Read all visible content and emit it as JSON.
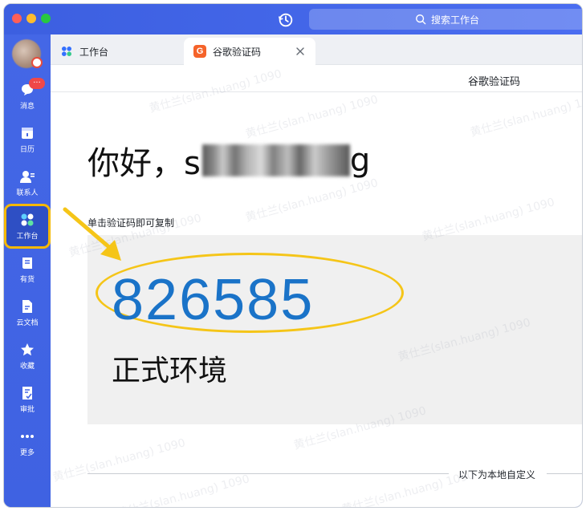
{
  "search": {
    "placeholder": "搜索工作台"
  },
  "sidebar": {
    "message_badge": "···",
    "items": [
      {
        "label": "消息",
        "icon": "chat-bubble-icon"
      },
      {
        "label": "日历",
        "icon": "calendar-icon"
      },
      {
        "label": "联系人",
        "icon": "contacts-icon"
      },
      {
        "label": "工作台",
        "icon": "workspace-grid-icon",
        "active": true
      },
      {
        "label": "有货",
        "icon": "book-icon"
      },
      {
        "label": "云文档",
        "icon": "cloud-doc-icon"
      },
      {
        "label": "收藏",
        "icon": "star-icon"
      },
      {
        "label": "审批",
        "icon": "approval-icon"
      },
      {
        "label": "更多",
        "icon": "more-dots-icon"
      }
    ]
  },
  "tabs": [
    {
      "label": "工作台",
      "icon": "workspace-grid-icon"
    },
    {
      "label": "谷歌验证码",
      "icon": "google-g-icon",
      "icon_letter": "G",
      "active": true
    }
  ],
  "page": {
    "header_title": "谷歌验证码",
    "greeting_prefix": "你好，s",
    "greeting_suffix": "g",
    "copy_hint": "单击验证码即可复制",
    "code": "826585",
    "environment": "正式环境",
    "divider_label": "以下为本地自定义"
  },
  "watermark": "黄仕兰(slan.huang) 1090",
  "colors": {
    "accent_blue": "#3f62e2",
    "code_blue": "#1a73c8",
    "annotation_yellow": "#f5c518",
    "badge_red": "#f04848",
    "g_icon_orange": "#f5632a"
  }
}
